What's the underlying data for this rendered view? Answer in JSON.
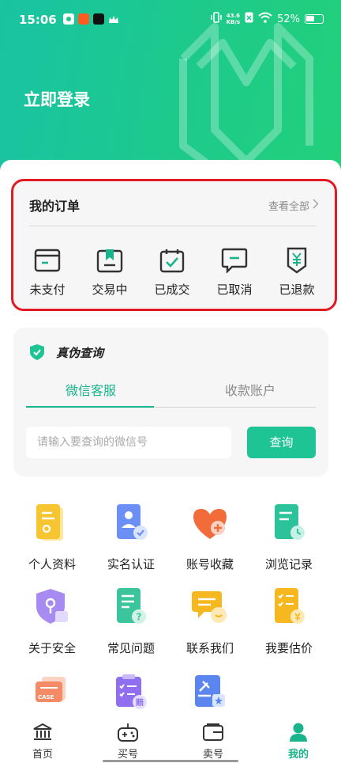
{
  "status_bar": {
    "time": "15:06",
    "net_speed_value": "43.6",
    "net_speed_unit": "KB/s",
    "battery": "52%"
  },
  "header": {
    "login_label": "立即登录"
  },
  "orders": {
    "title": "我的订单",
    "view_all": "查看全部",
    "items": [
      {
        "label": "未支付",
        "icon": "card-icon"
      },
      {
        "label": "交易中",
        "icon": "bookmark-box-icon"
      },
      {
        "label": "已成交",
        "icon": "calendar-check-icon"
      },
      {
        "label": "已取消",
        "icon": "message-minus-icon"
      },
      {
        "label": "已退款",
        "icon": "yen-shield-icon"
      }
    ]
  },
  "verify": {
    "title": "真伪查询",
    "tabs": [
      {
        "label": "微信客服",
        "active": true
      },
      {
        "label": "收款账户",
        "active": false
      }
    ],
    "input_placeholder": "请输入要查询的微信号",
    "button_label": "查询"
  },
  "services": [
    {
      "label": "个人资料",
      "icon": "profile-doc-icon"
    },
    {
      "label": "实名认证",
      "icon": "id-verify-icon"
    },
    {
      "label": "账号收藏",
      "icon": "heart-plus-icon"
    },
    {
      "label": "浏览记录",
      "icon": "history-doc-icon"
    },
    {
      "label": "关于安全",
      "icon": "security-shield-icon"
    },
    {
      "label": "常见问题",
      "icon": "faq-doc-icon"
    },
    {
      "label": "联系我们",
      "icon": "chat-bubble-icon"
    },
    {
      "label": "我要估价",
      "icon": "valuation-list-icon"
    },
    {
      "label": "",
      "icon": "case-folder-icon",
      "badge": "CASE"
    },
    {
      "label": "",
      "icon": "compensation-clipboard-icon",
      "badge": "赔"
    },
    {
      "label": "",
      "icon": "auction-doc-icon"
    }
  ],
  "tabbar": {
    "items": [
      {
        "label": "首页",
        "icon": "bank-icon",
        "active": false
      },
      {
        "label": "买号",
        "icon": "gamepad-icon",
        "active": false
      },
      {
        "label": "卖号",
        "icon": "wallet-icon",
        "active": false
      },
      {
        "label": "我的",
        "icon": "user-icon",
        "active": true
      }
    ]
  },
  "colors": {
    "accent": "#19b48c",
    "highlight_border": "#e11a23",
    "hero_start": "#19c3a3",
    "hero_end": "#22d07a"
  }
}
